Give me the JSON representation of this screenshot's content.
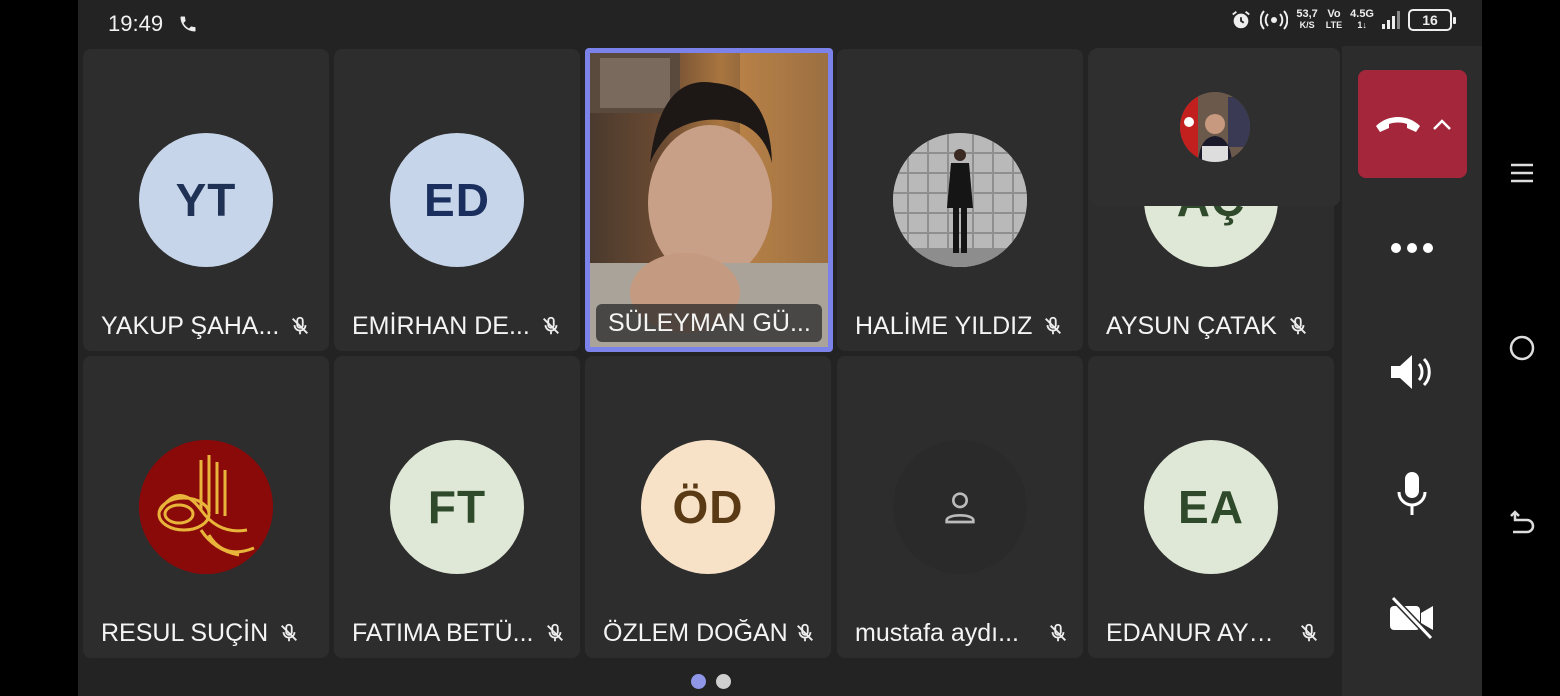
{
  "status_bar": {
    "time": "19:49",
    "net_speed_top": "53,7",
    "net_speed_bottom": "K/S",
    "volte_top": "Vo",
    "volte_bottom": "LTE",
    "network": "4.5G",
    "network_bottom": "1↓",
    "battery": "16"
  },
  "participants": [
    {
      "initials": "YT",
      "name": "YAKUP ŞAHA...",
      "avatar_bg": "#c7d5ea",
      "avatar_fg": "#1f3256"
    },
    {
      "initials": "ED",
      "name": "EMİRHAN DE...",
      "avatar_bg": "#c7d5ea",
      "avatar_fg": "#1b2f5e"
    },
    {
      "initials": "",
      "name": "SÜLEYMAN GÜ...",
      "video": true
    },
    {
      "initials": "",
      "name": "HALİME YILDIZ",
      "photo": true
    },
    {
      "initials": "AÇ",
      "name": "AYSUN ÇATAK",
      "avatar_bg": "#dfe8d6",
      "avatar_fg": "#2f4a2a"
    },
    {
      "initials": "",
      "name": "RESUL SUÇİN",
      "photo": true,
      "avatar_bg": "#8a0a0a"
    },
    {
      "initials": "FT",
      "name": "FATIMA BETÜ...",
      "avatar_bg": "#dfe8d6",
      "avatar_fg": "#2f4a2a"
    },
    {
      "initials": "ÖD",
      "name": "ÖZLEM DOĞAN",
      "avatar_bg": "#f7e2c8",
      "avatar_fg": "#5a3a14"
    },
    {
      "initials": "",
      "name": "mustafa aydı...",
      "generic": true
    },
    {
      "initials": "EA",
      "name": "EDANUR AYD...",
      "avatar_bg": "#dfe8d6",
      "avatar_fg": "#2f4a2a"
    }
  ],
  "controls": {
    "hangup_color": "#a4263a",
    "active_speaker_border": "#7b83eb",
    "icons": [
      "end-call-icon",
      "chevron-up-icon",
      "more-icon",
      "speaker-icon",
      "microphone-icon",
      "camera-off-icon"
    ]
  },
  "pagination": {
    "pages": 2,
    "current": 1
  },
  "android_nav": [
    "menu-icon",
    "home-icon",
    "back-icon"
  ]
}
